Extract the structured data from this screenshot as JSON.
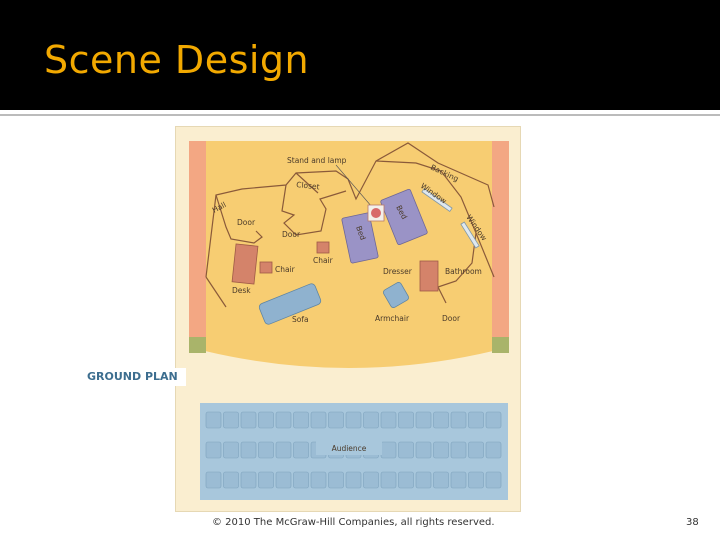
{
  "slide": {
    "title": "Scene Design",
    "footer": "© 2010 The McGraw-Hill Companies, all rights reserved.",
    "page_number": "38"
  },
  "diagram": {
    "caption": "GROUND PLAN",
    "labels": {
      "stand_and_lamp": "Stand and lamp",
      "backing": "Backing",
      "closet": "Closet",
      "hall": "Hall",
      "window_1": "Window",
      "window_2": "Window",
      "bed_1": "Bed",
      "bed_2": "Bed",
      "door_1": "Door",
      "door_2": "Door",
      "door_3": "Door",
      "chair_1": "Chair",
      "chair_2": "Chair",
      "desk": "Desk",
      "dresser": "Dresser",
      "bathroom": "Bathroom",
      "sofa": "Sofa",
      "armchair": "Armchair",
      "audience": "Audience"
    },
    "colors": {
      "stage": "#f7cd72",
      "proscenium": "#f3a783",
      "furniture_brown": "#d4836a",
      "furniture_purple": "#9a93c6",
      "furniture_blue": "#8fb2cf",
      "audience_block": "#a8c7dc",
      "seat": "#9bbcd4"
    }
  }
}
